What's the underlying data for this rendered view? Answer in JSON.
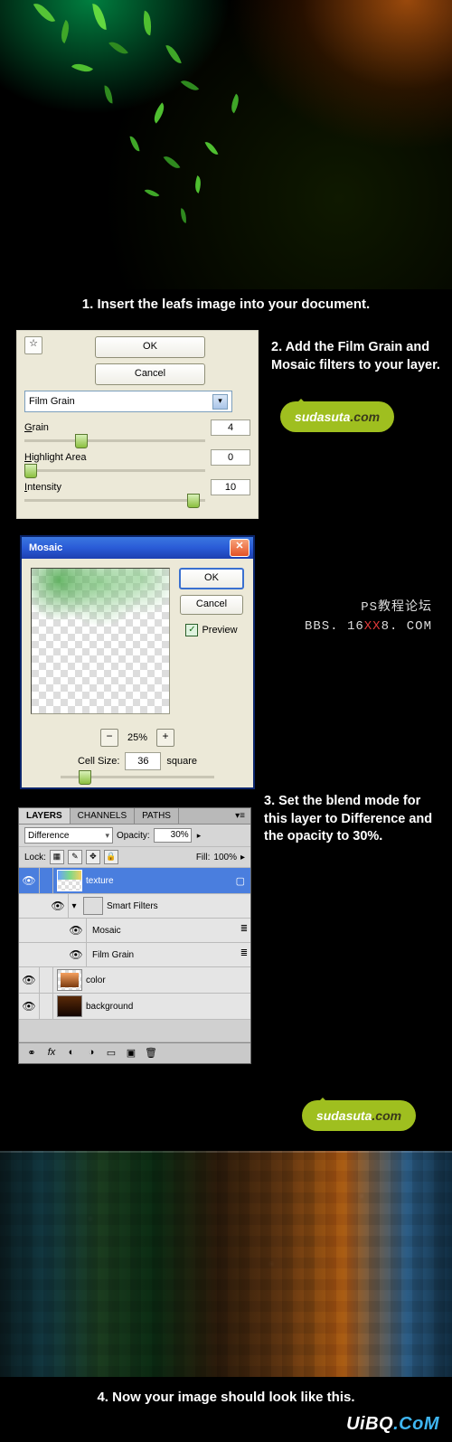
{
  "step1": {
    "caption": "1. Insert the leafs image into your document."
  },
  "step2": {
    "caption": "2. Add the Film Grain and Mosaic filters to your layer.",
    "ok": "OK",
    "cancel": "Cancel",
    "filter_name": "Film Grain",
    "grain_label": "Grain",
    "grain_value": "4",
    "highlight_label": "Highlight Area",
    "highlight_value": "0",
    "intensity_label": "Intensity",
    "intensity_value": "10",
    "collapse": "☆"
  },
  "badge": {
    "brand": "sudasuta",
    "tld": ".com"
  },
  "mosaic": {
    "title": "Mosaic",
    "ok": "OK",
    "cancel": "Cancel",
    "preview": "Preview",
    "zoom": "25%",
    "minus": "−",
    "plus": "+",
    "cell_label_pre": "Cell Size:",
    "cell_value": "36",
    "cell_label_post": "square"
  },
  "wm1": {
    "line1": "PS教程论坛",
    "line2a": "BBS. 16",
    "line2b": "XX",
    "line2c": "8. COM"
  },
  "step3": {
    "caption": "3. Set the blend mode for this layer to Difference and the opacity to 30%."
  },
  "layers": {
    "tab_layers": "LAYERS",
    "tab_channels": "CHANNELS",
    "tab_paths": "PATHS",
    "blend": "Difference",
    "opacity_label": "Opacity:",
    "opacity_value": "30%",
    "lock_label": "Lock:",
    "fill_label": "Fill:",
    "fill_value": "100%",
    "l_texture": "texture",
    "l_smart": "Smart Filters",
    "l_mosaic": "Mosaic",
    "l_filmgrain": "Film Grain",
    "l_color": "color",
    "l_background": "background",
    "chev_down": "▾",
    "chev_right": "▸",
    "link_icon": "⚭",
    "fx_icon": "≣"
  },
  "step4": {
    "caption": "4. Now your image should look like this."
  },
  "sitewm": {
    "a": "UiB",
    "b": "Q",
    "dot": ".",
    "c": "CoM"
  }
}
